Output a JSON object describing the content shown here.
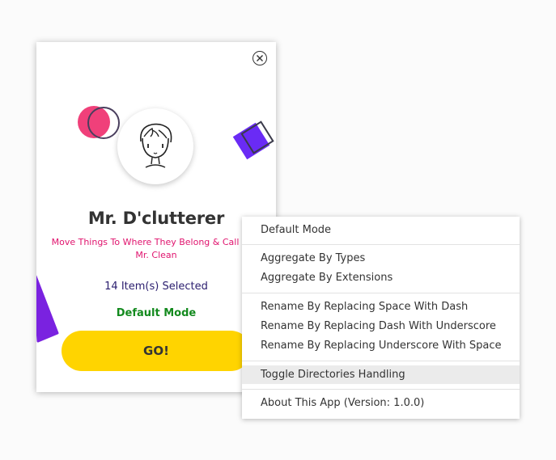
{
  "popup": {
    "title": "Mr. D'clutterer",
    "tagline": "Move Things To Where They Belong & Call Your Mr. Clean",
    "selected_count": "14 Item(s) Selected",
    "mode": "Default Mode",
    "go_label": "GO!",
    "close_icon": "close-icon",
    "avatar_icon": "cartoon-face-icon"
  },
  "context_menu": {
    "items": [
      {
        "label": "Default Mode"
      },
      {
        "label": "Aggregate By Types"
      },
      {
        "label": "Aggregate By Extensions"
      },
      {
        "label": "Rename By Replacing Space With Dash"
      },
      {
        "label": "Rename By Replacing Dash With Underscore"
      },
      {
        "label": "Rename By Replacing Underscore With Space"
      },
      {
        "label": "Toggle Directories Handling"
      },
      {
        "label": "About This App (Version: 1.0.0)"
      }
    ],
    "hovered_item": "Toggle Directories Handling"
  },
  "colors": {
    "accent_yellow": "#ffd400",
    "tagline_pink": "#e0146e",
    "mode_green": "#138a1e",
    "count_navy": "#2a1d6e",
    "deco_pink": "#f0407a",
    "deco_purple": "#6a2bf5",
    "deco_violet": "#7a22e0"
  }
}
